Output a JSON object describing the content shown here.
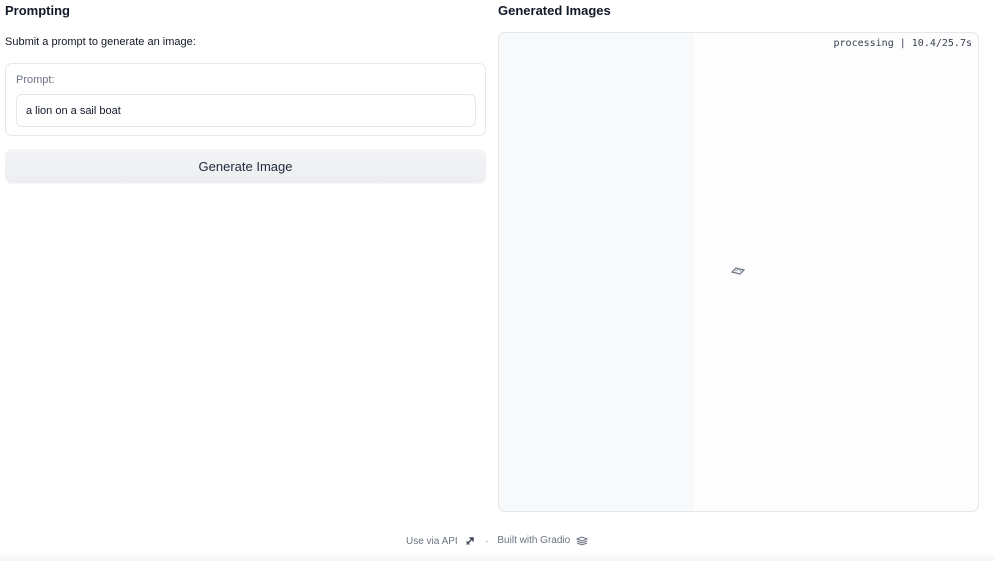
{
  "left": {
    "title": "Prompting",
    "instruction": "Submit a prompt to generate an image:",
    "prompt_label": "Prompt:",
    "prompt_value": "a lion on a sail boat",
    "generate_label": "Generate Image"
  },
  "right": {
    "title": "Generated Images",
    "status": "processing | 10.4/25.7s",
    "loader_icon": "loading-spinner-icon"
  },
  "footer": {
    "api_label": "Use via API",
    "api_icon": "rocket-icon",
    "separator": "·",
    "built_label": "Built with Gradio",
    "built_icon": "gradio-logo-icon"
  },
  "colors": {
    "border": "#e5e7eb",
    "button_bg": "#f3f4f6",
    "text": "#1f2937",
    "muted": "#6b7280"
  }
}
